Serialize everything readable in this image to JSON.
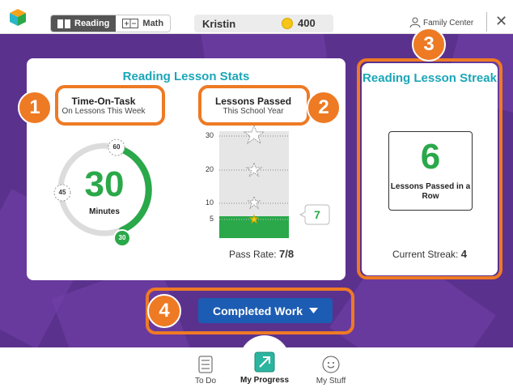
{
  "header": {
    "tabs": [
      {
        "label": "Reading",
        "icon": "book-icon",
        "active": true
      },
      {
        "label": "Math",
        "icon": "plus-minus-icon",
        "active": false
      }
    ],
    "student_name": "Kristin",
    "coins": "400",
    "family_center": "Family Center",
    "close_label": "✕"
  },
  "stats_card": {
    "title": "Reading Lesson Stats",
    "time_on_task": {
      "title": "Time-On-Task",
      "subtitle": "On Lessons This Week",
      "value": "30",
      "unit": "Minutes",
      "marker_60": "60",
      "marker_45": "45",
      "marker_30": "30"
    },
    "lessons_passed": {
      "title": "Lessons Passed",
      "subtitle": "This School Year",
      "value": "7",
      "pass_rate_label": "Pass Rate:",
      "pass_rate": "7/8",
      "ticks": [
        "30",
        "20",
        "10",
        "5"
      ]
    }
  },
  "streak_card": {
    "title": "Reading Lesson Streak",
    "value": "6",
    "label": "Lessons Passed in a Row",
    "current_label": "Current Streak:",
    "current_value": "4"
  },
  "completed_work": {
    "label": "Completed Work"
  },
  "annotations": [
    "1",
    "2",
    "3",
    "4"
  ],
  "bottom_nav": [
    {
      "label": "To Do",
      "icon": "checklist-icon"
    },
    {
      "label": "My Progress",
      "icon": "progress-arrow-icon",
      "active": true
    },
    {
      "label": "My Stuff",
      "icon": "smiley-icon"
    }
  ],
  "colors": {
    "accent_teal": "#1aa6b7",
    "green": "#2aa84a",
    "orange": "#ee7a24",
    "purple_bg": "#5b318e",
    "blue_button": "#1d5cb3"
  }
}
